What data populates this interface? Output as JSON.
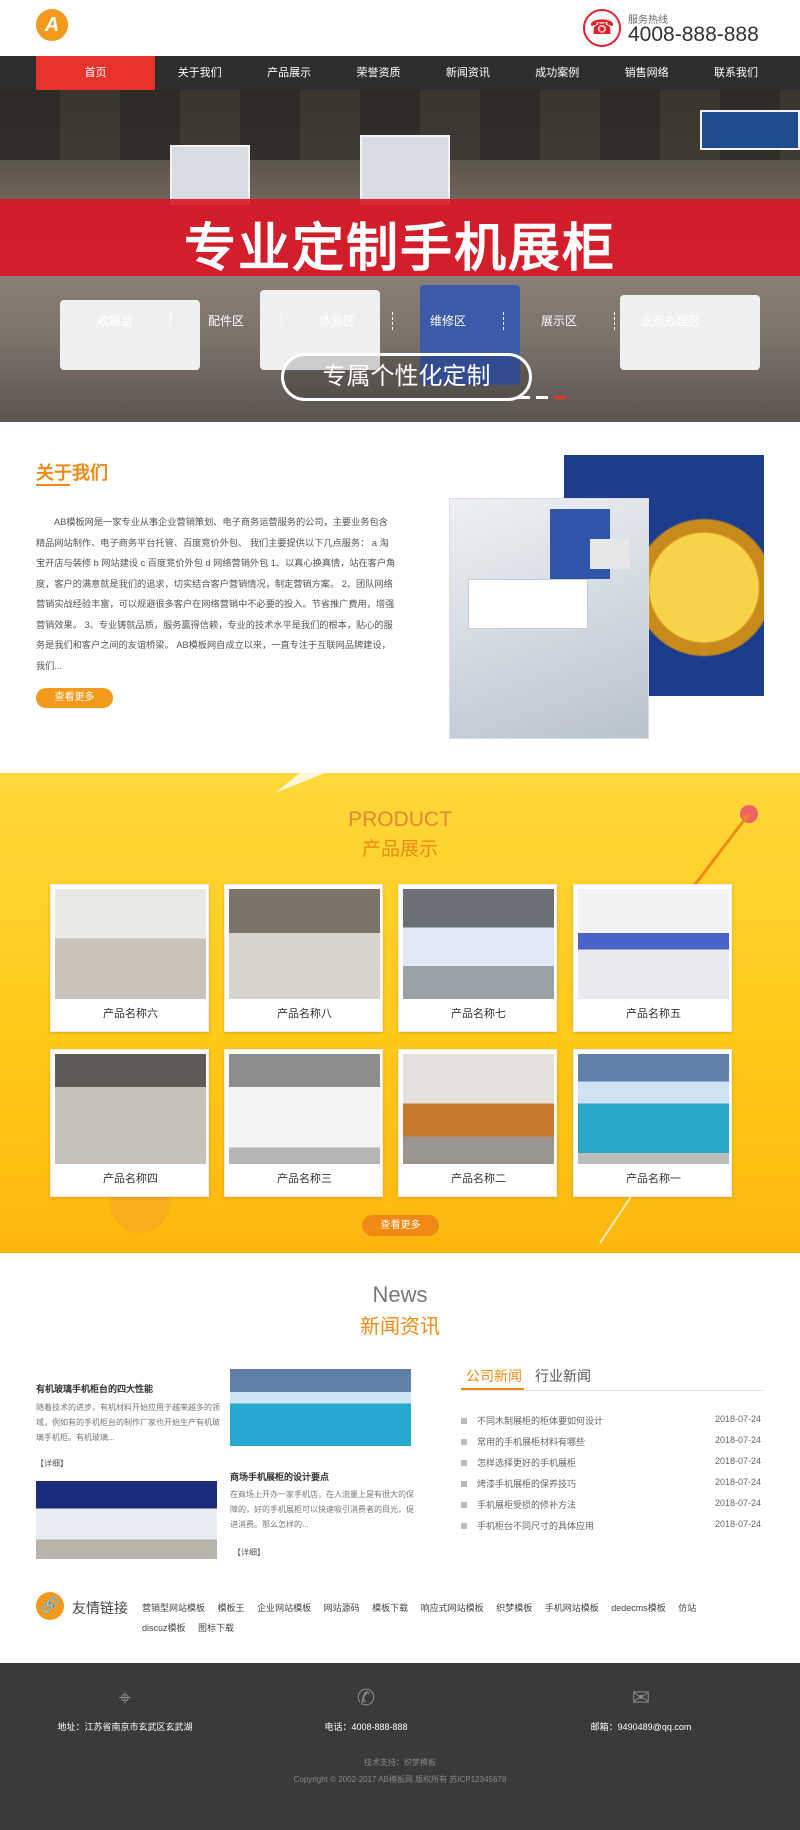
{
  "header": {
    "logo_letter": "A",
    "hotline_label": "服务热线",
    "hotline_number": "4008-888-888",
    "phone_icon": "phone-icon"
  },
  "nav": [
    "首页",
    "关于我们",
    "产品展示",
    "荣誉资质",
    "新闻资讯",
    "成功案例",
    "销售网络",
    "联系我们"
  ],
  "banner": {
    "title": "专业定制手机展柜",
    "zones": [
      "收银台",
      "配件区",
      "体验区",
      "维修区",
      "展示区",
      "业务办理区"
    ],
    "button": "专属个性化定制",
    "active_dot_color": "#e8322d"
  },
  "about": {
    "title": "关于我们",
    "text": "AB模板网是一家专业从事企业营销策划、电子商务运营服务的公司，主要业务包含精品网站制作、电子商务平台托管、百度竞价外包、 我们主要提供以下几点服务： a 淘宝开店与装修 b 网站建设 c 百度竞价外包 d 网络营销外包 1、以真心换真情，站在客户角度，客户的满意就是我们的追求，切实结合客户营销情况，制定营销方案。 2、团队网络营销实战经验丰富，可以规避很多客户在网络营销中不必要的投入。节省推广费用，增强营销效果。 3、专业铸就品质，服务赢得信赖，专业的技术水平是我们的根本，贴心的服务是我们和客户之间的友谊桥梁。 AB模板网自成立以来，一直专注于互联网品牌建设，我们...",
    "more": "查看更多"
  },
  "product": {
    "title_en": "PRODUCT",
    "title_cn": "产品展示",
    "items": [
      "产品名称六",
      "产品名称八",
      "产品名称七",
      "产品名称五",
      "产品名称四",
      "产品名称三",
      "产品名称二",
      "产品名称一"
    ],
    "more": "查看更多"
  },
  "news": {
    "title_en": "News",
    "title_cn": "新闻资讯",
    "feature1": {
      "title": "有机玻璃手机柜台的四大性能",
      "text": "随着技术的进步，有机材料开始应用于越来越多的领域，例如有的手机柜台的制作厂家也开始生产有机玻璃手机柜。有机玻璃...",
      "link": "【详细】"
    },
    "feature2": {
      "title": "商场手机展柜的设计要点",
      "text": "在商场上开办一家手机店，在人流量上是有很大的保障的，好的手机展柜可以快速吸引消费者的目光，促进消费。那么怎样的...",
      "link": "【详细】"
    },
    "tab_company": "公司新闻",
    "tab_industry": "行业新闻",
    "list": [
      {
        "title": "不同木制展柜的柜体要如何设计",
        "date": "2018-07-24"
      },
      {
        "title": "常用的手机展柜材料有哪些",
        "date": "2018-07-24"
      },
      {
        "title": "怎样选择更好的手机展柜",
        "date": "2018-07-24"
      },
      {
        "title": "烤漆手机展柜的保养技巧",
        "date": "2018-07-24"
      },
      {
        "title": "手机展柜受损的修补方法",
        "date": "2018-07-24"
      },
      {
        "title": "手机柜台不同尺寸的具体应用",
        "date": "2018-07-24"
      }
    ]
  },
  "links": {
    "title": "友情链接",
    "items": [
      "营销型网站模板",
      "模板王",
      "企业网站模板",
      "网站源码",
      "模板下载",
      "响应式网站模板",
      "织梦模板",
      "手机网站模板",
      "dedecms模板",
      "仿站",
      "discuz模板",
      "图标下载"
    ]
  },
  "footer": {
    "address": "地址：江苏省南京市玄武区玄武湖",
    "phone": "电话：4008-888-888",
    "email": "邮箱：9490489@qq.com",
    "tech": "技术支持：织梦模板",
    "copyright": "Copyright © 2002-2017 AB模板网 版权所有   苏ICP12345678"
  }
}
